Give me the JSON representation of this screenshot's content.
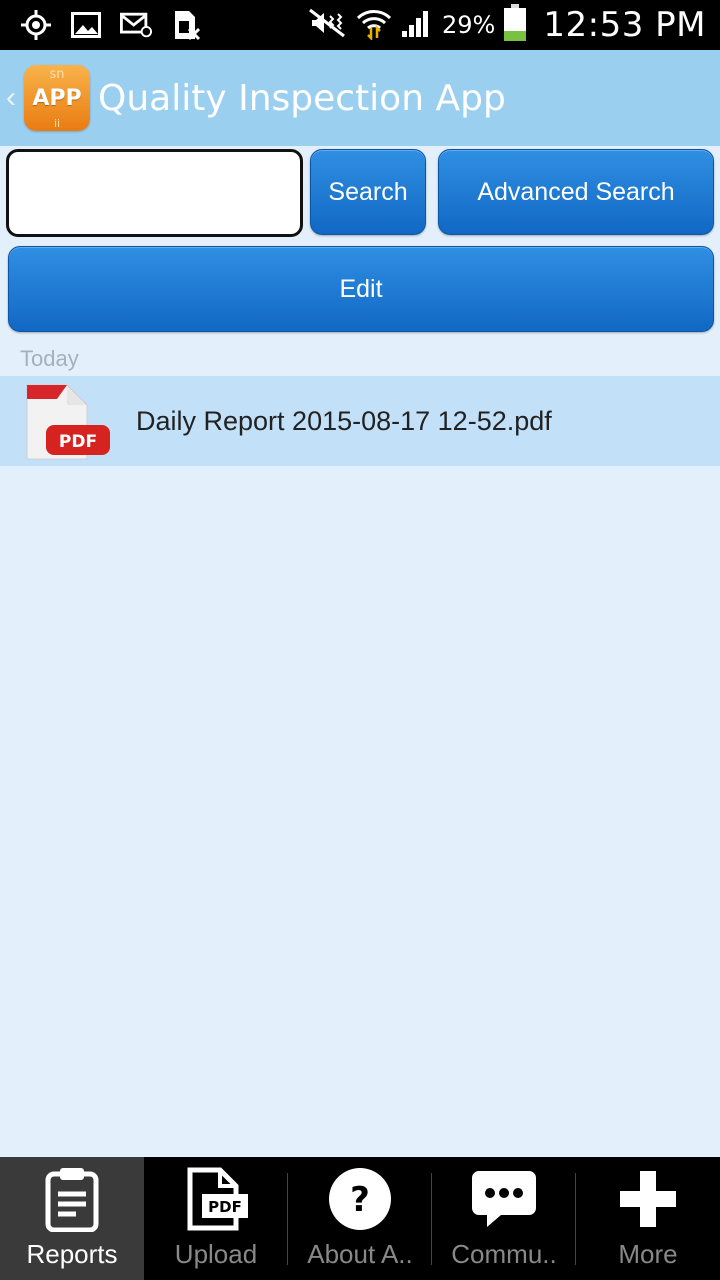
{
  "status_bar": {
    "icons": [
      "location-icon",
      "image-icon",
      "email-icon",
      "sim-icon",
      "mute-icon",
      "wifi-icon",
      "signal-icon",
      "battery-icon"
    ],
    "battery_percent": "29%",
    "time": "12:53 PM"
  },
  "header": {
    "title": "Quality Inspection App",
    "logo_text": "APP",
    "logo_top": "sn",
    "logo_bottom": "ii",
    "accent": "#9bcff0"
  },
  "search": {
    "value": "",
    "search_label": "Search",
    "advanced_label": "Advanced Search"
  },
  "edit_label": "Edit",
  "list": {
    "section": "Today",
    "items": [
      {
        "name": "Daily Report 2015-08-17 12-52.pdf",
        "icon": "pdf-icon",
        "badge": "PDF"
      }
    ]
  },
  "tabs": [
    {
      "label": "Reports",
      "icon": "clipboard-icon",
      "active": true
    },
    {
      "label": "Upload",
      "icon": "pdf-upload-icon",
      "badge": "PDF"
    },
    {
      "label": "About A..",
      "icon": "help-icon",
      "glyph": "?"
    },
    {
      "label": "Commu..",
      "icon": "chat-icon"
    },
    {
      "label": "More",
      "icon": "plus-icon"
    }
  ],
  "colors": {
    "button": "#1f7fd6",
    "list_highlight": "#c2e0f8",
    "background": "#e3f0fb"
  }
}
